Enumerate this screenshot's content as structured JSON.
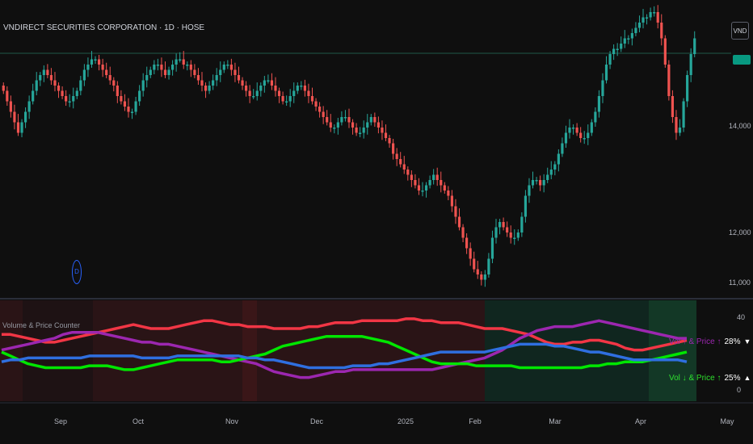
{
  "header": {
    "title": "VNDIRECT SECURITIES CORPORATION · 1D · HOSE",
    "symbol_button": "VND"
  },
  "price_axis": {
    "labels": [
      "14,000",
      "12,000",
      "11,000"
    ]
  },
  "time_axis": {
    "labels": [
      "Sep",
      "Oct",
      "Nov",
      "Dec",
      "2025",
      "Feb",
      "Mar",
      "Apr",
      "May"
    ]
  },
  "indicator": {
    "title": "Volume & Price Counter",
    "axis_labels": [
      "40",
      "0"
    ],
    "legend": [
      {
        "label": "Vol ↑ & Price ↑",
        "value": "28%",
        "arrow": "▼",
        "color": "#9c27b0"
      },
      {
        "label": "Vol ↓ & Price ↑",
        "value": "25%",
        "arrow": "▲",
        "color": "#2ee02e"
      }
    ]
  },
  "marker": {
    "glyph": "D"
  },
  "colors": {
    "up": "#26a69a",
    "down": "#ef5350",
    "red_line": "#f23645",
    "purple_line": "#9c27b0",
    "green_line": "#00e600",
    "blue_line": "#2f6fe0"
  },
  "chart_data": [
    {
      "type": "candlestick",
      "title": "VNDIRECT SECURITIES CORPORATION · 1D · HOSE",
      "x_range": [
        "2024-08-05",
        "2025-04-18"
      ],
      "close": [
        14700,
        14500,
        14300,
        14100,
        13900,
        14100,
        14300,
        14500,
        14700,
        14900,
        15000,
        15100,
        15000,
        14900,
        14800,
        14700,
        14600,
        14500,
        14500,
        14600,
        14700,
        14900,
        15100,
        15200,
        15300,
        15300,
        15200,
        15100,
        15000,
        14900,
        14800,
        14600,
        14500,
        14400,
        14300,
        14300,
        14500,
        14700,
        14900,
        15000,
        15100,
        15200,
        15200,
        15100,
        15000,
        15100,
        15200,
        15300,
        15300,
        15200,
        15200,
        15100,
        15000,
        14900,
        14800,
        14700,
        14800,
        14900,
        15000,
        15100,
        15200,
        15200,
        15100,
        15000,
        14900,
        14800,
        14700,
        14600,
        14600,
        14700,
        14800,
        14900,
        14900,
        14800,
        14700,
        14600,
        14500,
        14500,
        14600,
        14700,
        14800,
        14800,
        14700,
        14600,
        14500,
        14400,
        14300,
        14200,
        14100,
        14000,
        14000,
        14100,
        14200,
        14200,
        14100,
        14000,
        13900,
        13900,
        14000,
        14100,
        14200,
        14100,
        14000,
        13900,
        13800,
        13700,
        13500,
        13400,
        13300,
        13200,
        13100,
        13000,
        12900,
        12800,
        12800,
        12900,
        13000,
        13100,
        13000,
        12900,
        12800,
        12700,
        12500,
        12300,
        12100,
        11900,
        11700,
        11500,
        11300,
        11200,
        11100,
        11200,
        11500,
        11900,
        12100,
        12200,
        12100,
        12000,
        11900,
        11900,
        12000,
        12300,
        12700,
        12900,
        13000,
        13000,
        12900,
        13000,
        13100,
        13200,
        13300,
        13500,
        13700,
        13900,
        14000,
        14000,
        13900,
        13800,
        13800,
        13900,
        14100,
        14300,
        14600,
        14900,
        15200,
        15400,
        15500,
        15500,
        15600,
        15700,
        15700,
        15800,
        15900,
        16000,
        16100,
        16100,
        16200,
        16200,
        16000,
        15700,
        15200,
        14600,
        14200,
        13900,
        14000,
        14500,
        15000,
        15400,
        15700
      ],
      "price_ticks": [
        14000,
        12000,
        11000
      ],
      "indicator": {
        "name": "Volume & Price Counter",
        "ylim": [
          0,
          40
        ],
        "series": [
          {
            "name": "red",
            "color": "#f23645",
            "values": [
              30,
              30,
              29,
              28,
              27,
              26,
              26,
              27,
              28,
              29,
              30,
              31,
              32,
              33,
              34,
              35,
              34,
              33,
              33,
              33,
              34,
              35,
              36,
              37,
              37,
              36,
              35,
              35,
              34,
              34,
              34,
              33,
              33,
              33,
              33,
              34,
              34,
              35,
              36,
              36,
              36,
              37,
              37,
              37,
              37,
              37,
              38,
              38,
              37,
              37,
              36,
              36,
              36,
              35,
              34,
              33,
              33,
              33,
              32,
              31,
              30,
              28,
              26,
              25,
              25,
              26,
              26,
              27,
              27,
              26,
              25,
              23,
              22,
              22,
              23,
              24,
              25,
              26,
              27
            ]
          },
          {
            "name": "purple",
            "color": "#9c27b0",
            "values": [
              22,
              23,
              24,
              25,
              26,
              27,
              28,
              30,
              31,
              31,
              31,
              31,
              30,
              29,
              28,
              27,
              26,
              26,
              25,
              25,
              24,
              23,
              22,
              21,
              20,
              19,
              18,
              17,
              16,
              15,
              13,
              11,
              10,
              9,
              8,
              8,
              9,
              10,
              11,
              11,
              12,
              12,
              12,
              12,
              12,
              12,
              12,
              12,
              12,
              12,
              13,
              14,
              15,
              16,
              17,
              18,
              20,
              22,
              25,
              28,
              30,
              32,
              33,
              34,
              34,
              34,
              35,
              36,
              37,
              36,
              35,
              34,
              33,
              32,
              31,
              30,
              29,
              28,
              28
            ]
          },
          {
            "name": "green",
            "color": "#00e600",
            "values": [
              21,
              19,
              17,
              15,
              14,
              13,
              13,
              13,
              13,
              13,
              14,
              14,
              14,
              13,
              12,
              12,
              13,
              14,
              15,
              16,
              17,
              17,
              17,
              17,
              17,
              16,
              16,
              17,
              18,
              19,
              20,
              22,
              24,
              25,
              26,
              27,
              28,
              29,
              29,
              29,
              29,
              29,
              28,
              27,
              26,
              24,
              22,
              20,
              18,
              16,
              15,
              15,
              15,
              15,
              14,
              14,
              14,
              14,
              14,
              13,
              13,
              13,
              13,
              13,
              13,
              13,
              13,
              14,
              14,
              15,
              15,
              16,
              16,
              16,
              17,
              18,
              19,
              20,
              21
            ]
          },
          {
            "name": "blue",
            "color": "#2f6fe0",
            "values": [
              16,
              17,
              17,
              18,
              18,
              18,
              18,
              18,
              18,
              18,
              19,
              19,
              19,
              19,
              19,
              19,
              18,
              18,
              18,
              18,
              19,
              19,
              19,
              19,
              19,
              19,
              19,
              19,
              18,
              18,
              17,
              17,
              16,
              15,
              14,
              13,
              13,
              13,
              13,
              13,
              14,
              14,
              14,
              15,
              15,
              16,
              17,
              18,
              19,
              20,
              21,
              21,
              21,
              21,
              21,
              21,
              22,
              23,
              24,
              25,
              25,
              25,
              25,
              24,
              24,
              23,
              22,
              21,
              21,
              20,
              19,
              18,
              17,
              17,
              17,
              17,
              17,
              17,
              16
            ]
          }
        ]
      }
    }
  ]
}
